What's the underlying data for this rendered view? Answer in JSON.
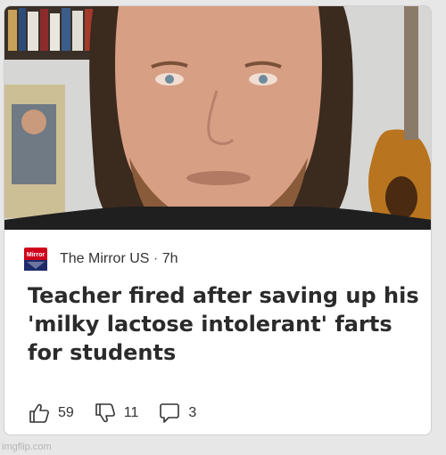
{
  "article": {
    "source_name": "The Mirror US",
    "separator": "·",
    "age": "7h",
    "logo_text": "Mirror",
    "headline": "Teacher fired after saving up his 'milky lactose intolerant' farts for students",
    "image_icon": "photo-of-bearded-man"
  },
  "reactions": {
    "likes": "59",
    "dislikes": "11",
    "comments": "3"
  },
  "icons": {
    "like": "thumbs-up-icon",
    "dislike": "thumbs-down-icon",
    "comment": "comment-icon"
  },
  "watermark": "imgflip.com",
  "colors": {
    "brand_red": "#d0021b",
    "headline_text": "#2b2b2b",
    "background": "#e7e7e7"
  }
}
